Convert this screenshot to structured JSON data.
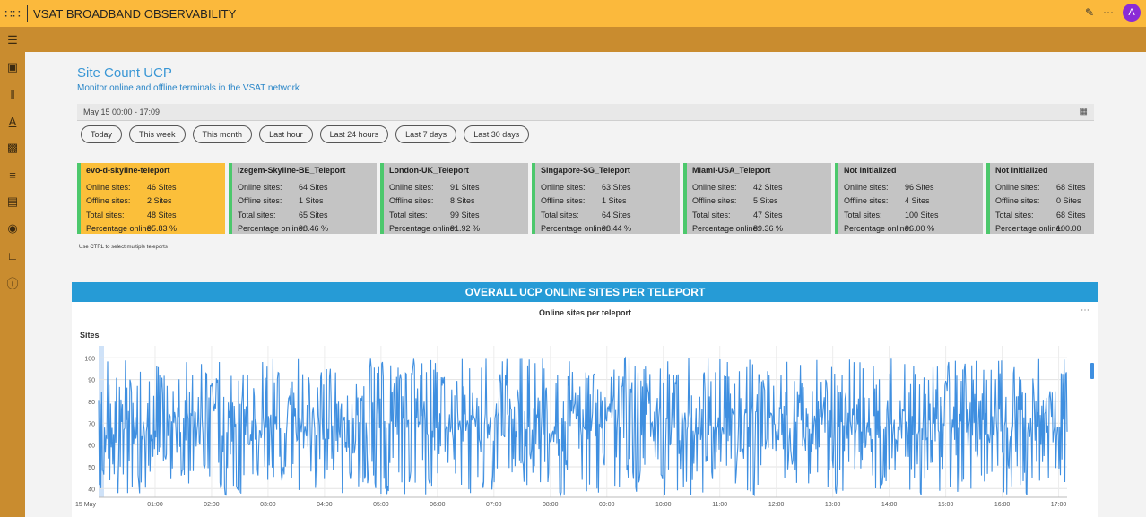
{
  "app": {
    "title": "VSAT BROADBAND OBSERVABILITY",
    "avatar_initial": "A"
  },
  "icons": {
    "app_grid": "grid-icon",
    "edit": "pencil-icon",
    "more": "ellipsis-icon",
    "sidebar": [
      "menu-icon",
      "dashboard-icon",
      "columns-icon",
      "text-icon",
      "analytics-icon",
      "list-icon",
      "report-icon",
      "globe-icon",
      "chart-icon",
      "info-icon"
    ],
    "calendar": "calendar-icon"
  },
  "page": {
    "title": "Site Count UCP",
    "subtitle": "Monitor online and offline terminals in the VSAT network"
  },
  "date_range": {
    "value": "May 15 00:00 - 17:09"
  },
  "presets": [
    "Today",
    "This week",
    "This month",
    "Last hour",
    "Last 24 hours",
    "Last 7 days",
    "Last 30 days"
  ],
  "cards": [
    {
      "name": "evo-d-skyline-teleport",
      "online": "46 Sites",
      "offline": "2 Sites",
      "total": "48 Sites",
      "pct": "95.83 %",
      "selected": true
    },
    {
      "name": "Izegem-Skyline-BE_Teleport",
      "online": "64 Sites",
      "offline": "1 Sites",
      "total": "65 Sites",
      "pct": "98.46 %",
      "selected": false
    },
    {
      "name": "London-UK_Teleport",
      "online": "91 Sites",
      "offline": "8 Sites",
      "total": "99 Sites",
      "pct": "91.92 %",
      "selected": false
    },
    {
      "name": "Singapore-SG_Teleport",
      "online": "63 Sites",
      "offline": "1 Sites",
      "total": "64 Sites",
      "pct": "98.44 %",
      "selected": false
    },
    {
      "name": "Miami-USA_Teleport",
      "online": "42 Sites",
      "offline": "5 Sites",
      "total": "47 Sites",
      "pct": "89.36 %",
      "selected": false
    },
    {
      "name": "Not initialized",
      "online": "96 Sites",
      "offline": "4 Sites",
      "total": "100 Sites",
      "pct": "96.00 %",
      "selected": false
    },
    {
      "name": "Not initialized",
      "online": "68 Sites",
      "offline": "0 Sites",
      "total": "68 Sites",
      "pct": "100.00",
      "selected": false
    }
  ],
  "card_labels": {
    "online": "Online sites:",
    "offline": "Offline sites:",
    "total": "Total sites:",
    "pct": "Percentage online:"
  },
  "hint": "Use CTRL to select multiple teleports",
  "chart_section": {
    "header": "OVERALL UCP ONLINE SITES PER TELEPORT"
  },
  "chart_data": {
    "type": "line",
    "title": "Online sites per teleport",
    "ylabel": "Sites",
    "xlabel": "",
    "ylim": [
      36,
      103
    ],
    "yticks": [
      40,
      50,
      60,
      70,
      80,
      90,
      100
    ],
    "x_tick_labels": [
      "15 May",
      "01:00",
      "02:00",
      "03:00",
      "04:00",
      "05:00",
      "06:00",
      "07:00",
      "08:00",
      "09:00",
      "10:00",
      "11:00",
      "12:00",
      "13:00",
      "14:00",
      "15:00",
      "16:00",
      "17:00"
    ],
    "x_range_hours": [
      0,
      17.15
    ],
    "series_count_note": "",
    "series": [
      {
        "values_summary": {
          "min": 37,
          "max": 100
        }
      }
    ],
    "grid": true,
    "colors": {
      "line": "#3f8fe0"
    }
  },
  "colors": {
    "brand": "#fbb93c",
    "sidebar": "#c98c2f",
    "accent": "#269bd6",
    "selected_card": "#fbbf3a",
    "card": "#c4c4c4",
    "card_border": "#4cc86c"
  }
}
